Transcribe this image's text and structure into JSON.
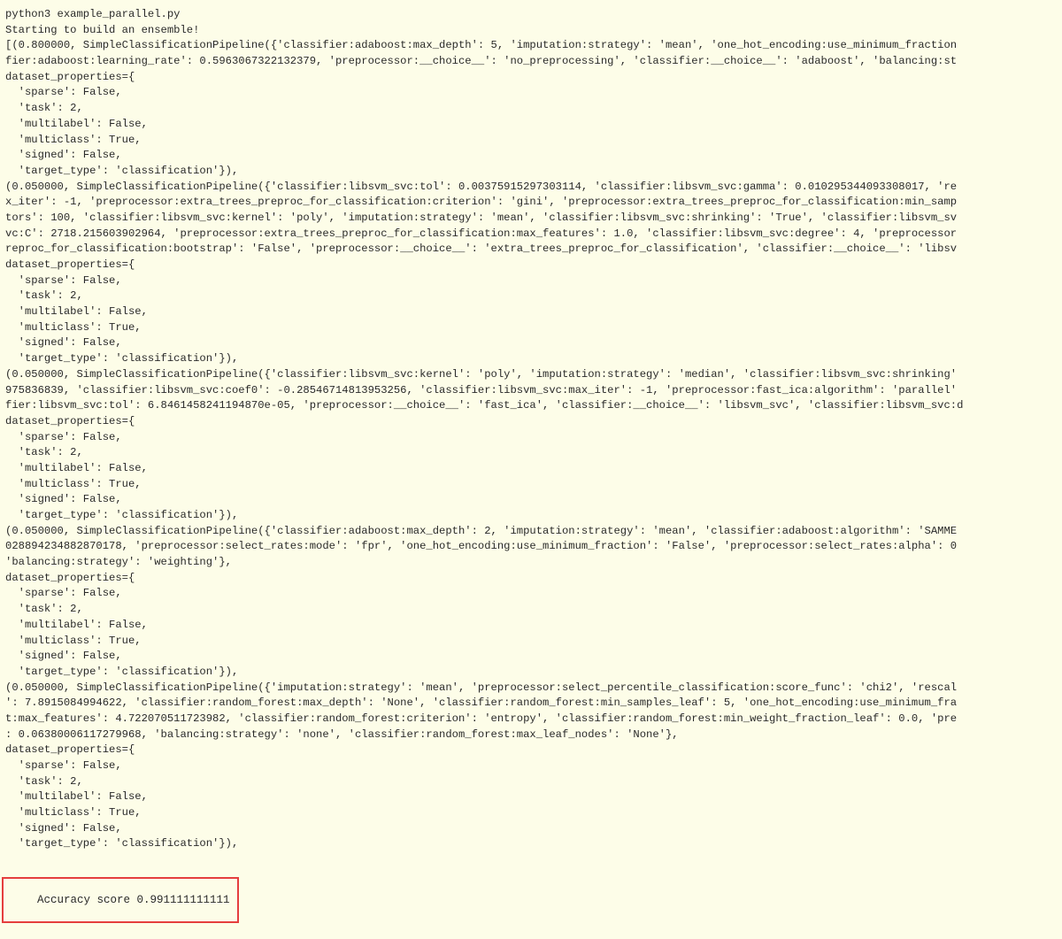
{
  "terminal": {
    "lines": [
      "python3 example_parallel.py",
      "Starting to build an ensemble!",
      "[(0.800000, SimpleClassificationPipeline({'classifier:adaboost:max_depth': 5, 'imputation:strategy': 'mean', 'one_hot_encoding:use_minimum_fraction",
      "fier:adaboost:learning_rate': 0.5963067322132379, 'preprocessor:__choice__': 'no_preprocessing', 'classifier:__choice__': 'adaboost', 'balancing:st",
      "dataset_properties={",
      "  'sparse': False,",
      "  'task': 2,",
      "  'multilabel': False,",
      "  'multiclass': True,",
      "  'signed': False,",
      "  'target_type': 'classification'}),",
      "(0.050000, SimpleClassificationPipeline({'classifier:libsvm_svc:tol': 0.00375915297303114, 'classifier:libsvm_svc:gamma': 0.010295344093308017, 're",
      "x_iter': -1, 'preprocessor:extra_trees_preproc_for_classification:criterion': 'gini', 'preprocessor:extra_trees_preproc_for_classification:min_samp",
      "tors': 100, 'classifier:libsvm_svc:kernel': 'poly', 'imputation:strategy': 'mean', 'classifier:libsvm_svc:shrinking': 'True', 'classifier:libsvm_sv",
      "vc:C': 2718.215603902964, 'preprocessor:extra_trees_preproc_for_classification:max_features': 1.0, 'classifier:libsvm_svc:degree': 4, 'preprocessor",
      "reproc_for_classification:bootstrap': 'False', 'preprocessor:__choice__': 'extra_trees_preproc_for_classification', 'classifier:__choice__': 'libsv",
      "dataset_properties={",
      "  'sparse': False,",
      "  'task': 2,",
      "  'multilabel': False,",
      "  'multiclass': True,",
      "  'signed': False,",
      "  'target_type': 'classification'}),",
      "(0.050000, SimpleClassificationPipeline({'classifier:libsvm_svc:kernel': 'poly', 'imputation:strategy': 'median', 'classifier:libsvm_svc:shrinking'",
      "975836839, 'classifier:libsvm_svc:coef0': -0.28546714813953256, 'classifier:libsvm_svc:max_iter': -1, 'preprocessor:fast_ica:algorithm': 'parallel'",
      "fier:libsvm_svc:tol': 6.8461458241194870e-05, 'preprocessor:__choice__': 'fast_ica', 'classifier:__choice__': 'libsvm_svc', 'classifier:libsvm_svc:d",
      "dataset_properties={",
      "  'sparse': False,",
      "  'task': 2,",
      "  'multilabel': False,",
      "  'multiclass': True,",
      "  'signed': False,",
      "  'target_type': 'classification'}),",
      "(0.050000, SimpleClassificationPipeline({'classifier:adaboost:max_depth': 2, 'imputation:strategy': 'mean', 'classifier:adaboost:algorithm': 'SAMME",
      "028894234882870178, 'preprocessor:select_rates:mode': 'fpr', 'one_hot_encoding:use_minimum_fraction': 'False', 'preprocessor:select_rates:alpha': 0",
      "'balancing:strategy': 'weighting'},",
      "dataset_properties={",
      "  'sparse': False,",
      "  'task': 2,",
      "  'multilabel': False,",
      "  'multiclass': True,",
      "  'signed': False,",
      "  'target_type': 'classification'}),",
      "(0.050000, SimpleClassificationPipeline({'imputation:strategy': 'mean', 'preprocessor:select_percentile_classification:score_func': 'chi2', 'rescal",
      "': 7.8915084994622, 'classifier:random_forest:max_depth': 'None', 'classifier:random_forest:min_samples_leaf': 5, 'one_hot_encoding:use_minimum_fra",
      "t:max_features': 4.722070511723982, 'classifier:random_forest:criterion': 'entropy', 'classifier:random_forest:min_weight_fraction_leaf': 0.0, 'pre",
      ": 0.06380006117279968, 'balancing:strategy': 'none', 'classifier:random_forest:max_leaf_nodes': 'None'},",
      "dataset_properties={",
      "  'sparse': False,",
      "  'task': 2,",
      "  'multilabel': False,",
      "  'multiclass': True,",
      "  'signed': False,",
      "  'target_type': 'classification'}),"
    ],
    "accuracy_label": "Accuracy score 0.991111111111"
  }
}
